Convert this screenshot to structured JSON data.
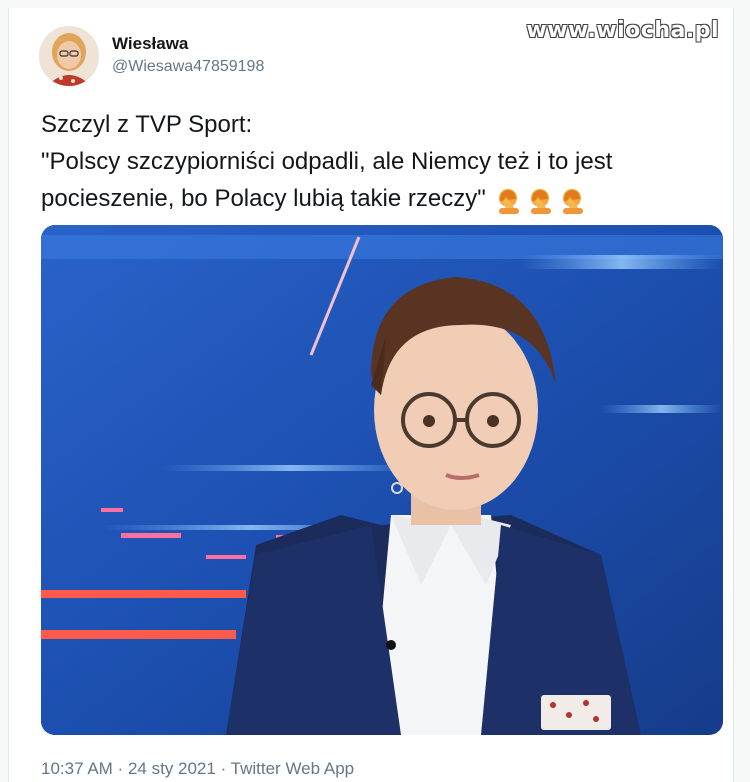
{
  "watermark": "www.wiocha.pl",
  "author": {
    "name": "Wiesława",
    "handle": "@Wiesawa47859198"
  },
  "tweet": {
    "lines": [
      "Szczyl z TVP Sport:",
      "\"Polscy szczypiorniści odpadli, ale Niemcy też i to jest",
      "pocieszenie, bo Polacy lubią takie rzeczy\""
    ],
    "emojis": [
      "facepalm-icon",
      "facepalm-icon",
      "facepalm-icon"
    ]
  },
  "footer": {
    "time": "10:37 AM",
    "separator": " · ",
    "date": "24 sty 2021",
    "source": "Twitter Web App"
  },
  "colors": {
    "text": "#14171a",
    "secondary": "#657786",
    "studio_blue": "#1f4aa0",
    "emoji": "#f4a73a"
  }
}
